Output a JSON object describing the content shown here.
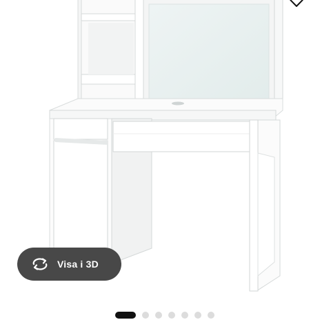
{
  "product_viewer": {
    "favorite_icon": "heart-outline-icon",
    "view_3d_button": {
      "label": "Visa i 3D",
      "icon": "rotate-3d-icon"
    },
    "carousel": {
      "total_images": 7,
      "active_index": 0
    }
  },
  "colors": {
    "button_background": "#484848",
    "button_text": "#ffffff",
    "dot_active": "#111111",
    "dot_inactive": "#dcdcdc"
  }
}
